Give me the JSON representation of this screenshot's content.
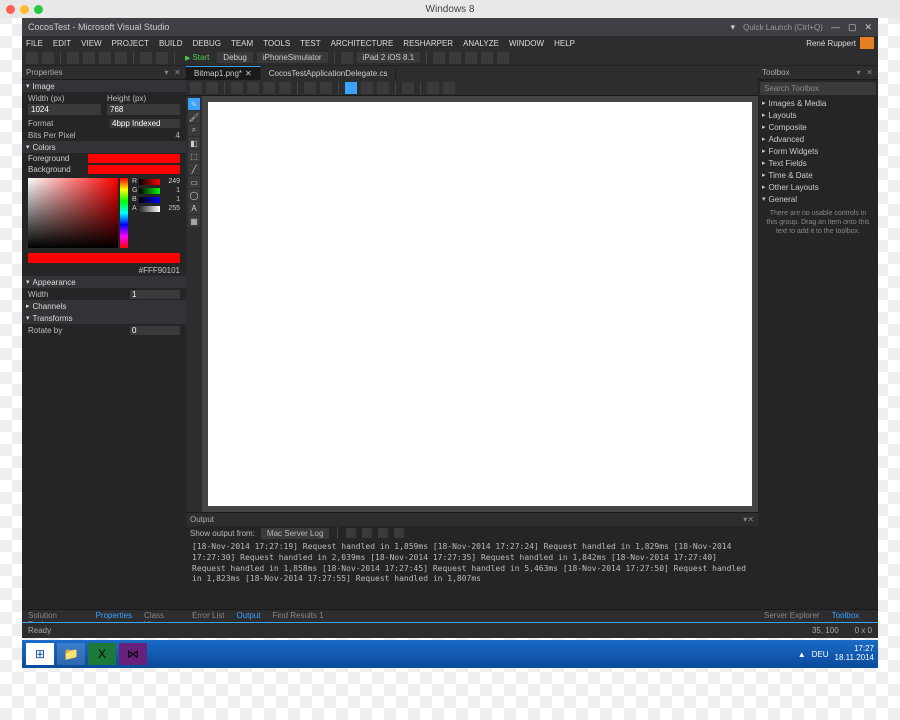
{
  "mac": {
    "title": "Windows 8"
  },
  "vs": {
    "title": "CocosTest - Microsoft Visual Studio",
    "quick_launch": "Quick Launch (Ctrl+Q)",
    "user": "René Ruppert",
    "menu": [
      "FILE",
      "EDIT",
      "VIEW",
      "PROJECT",
      "BUILD",
      "DEBUG",
      "TEAM",
      "TOOLS",
      "TEST",
      "ARCHITECTURE",
      "RESHARPER",
      "ANALYZE",
      "WINDOW",
      "HELP"
    ],
    "start": "Start",
    "config": "Debug",
    "platform": "iPhoneSimulator",
    "device": "iPad 2 iOS 8.1"
  },
  "props": {
    "title": "Properties",
    "image": {
      "hdr": "Image",
      "width_l": "Width (px)",
      "width": "1024",
      "height_l": "Height (px)",
      "height": "768",
      "format_l": "Format",
      "format": "4bpp Indexed",
      "bpp_l": "Bits Per Pixel",
      "bpp": "4"
    },
    "colors": {
      "hdr": "Colors",
      "fg_l": "Foreground",
      "bg_l": "Background",
      "fg": "#ff0000",
      "bg": "#ff0000",
      "r": "249",
      "g": "1",
      "b": "1",
      "a": "255",
      "hex": "#FFF90101"
    },
    "appearance": {
      "hdr": "Appearance",
      "width_l": "Width",
      "width": "1"
    },
    "channels": {
      "hdr": "Channels"
    },
    "transforms": {
      "hdr": "Transforms",
      "rotate_l": "Rotate by",
      "rotate": "0"
    },
    "tabs": [
      "Solution Explorer",
      "Properties",
      "Class View"
    ],
    "active_tab": 1
  },
  "docs": {
    "tabs": [
      "Bitmap1.png*",
      "CocosTestApplicationDelegate.cs"
    ],
    "active": 0
  },
  "toolbox": {
    "title": "Toolbox",
    "search_ph": "Search Toolbox",
    "cats": [
      "Images & Media",
      "Layouts",
      "Composite",
      "Advanced",
      "Form Widgets",
      "Text Fields",
      "Time & Date",
      "Other Layouts",
      "General"
    ],
    "msg": "There are no usable controls in this group. Drag an item onto this text to add it to the toolbox.",
    "tabs": [
      "Server Explorer",
      "Toolbox"
    ],
    "active_tab": 1
  },
  "output": {
    "title": "Output",
    "from_l": "Show output from:",
    "from": "Mac Server Log",
    "lines": [
      "[18-Nov-2014 17:27:19] Request handled in 1,859ms",
      "[18-Nov-2014 17:27:24] Request handled in 1,829ms",
      "[18-Nov-2014 17:27:30] Request handled in 2,039ms",
      "[18-Nov-2014 17:27:35] Request handled in 1,842ms",
      "[18-Nov-2014 17:27:40] Request handled in 1,858ms",
      "[18-Nov-2014 17:27:45] Request handled in 5,463ms",
      "[18-Nov-2014 17:27:50] Request handled in 1,823ms",
      "[18-Nov-2014 17:27:55] Request handled in 1,807ms"
    ],
    "tabs": [
      "Error List",
      "Output",
      "Find Results 1"
    ],
    "active_tab": 1
  },
  "status": {
    "ready": "Ready",
    "coords": "35, 100",
    "size": "0 x 0"
  },
  "taskbar": {
    "time": "17:27",
    "date": "18.11.2014",
    "lang": "DEU"
  }
}
